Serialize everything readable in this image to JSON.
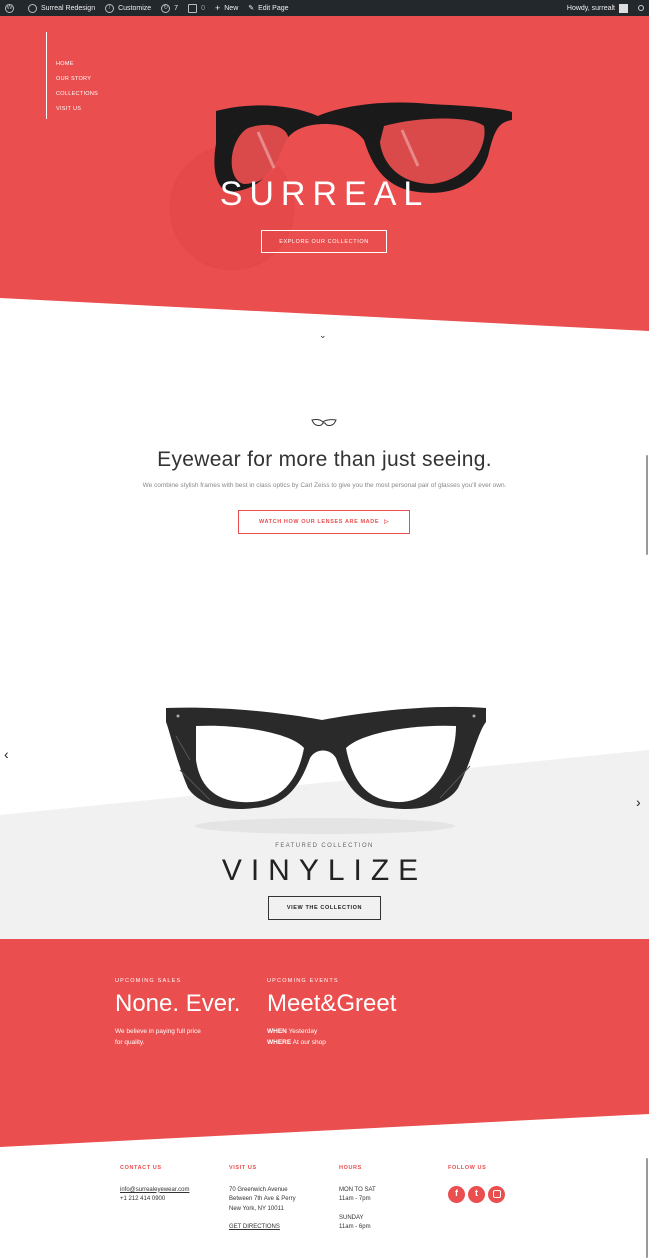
{
  "adminbar": {
    "site_name": "Surreal Redesign",
    "customize": "Customize",
    "updates_count": "7",
    "comments_count": "0",
    "new_label": "New",
    "edit_page": "Edit Page",
    "howdy": "Howdy, surrealt"
  },
  "nav": {
    "items": [
      "HOME",
      "OUR STORY",
      "COLLECTIONS",
      "VISIT US"
    ]
  },
  "hero": {
    "logo": "SURREAL",
    "button": "EXPLORE OUR COLLECTION"
  },
  "intro": {
    "title": "Eyewear for more than just seeing.",
    "text": "We combine stylish frames with best in class optics by Carl Zeiss to give you the most personal pair of glasses you'll ever own.",
    "button": "WATCH HOW OUR LENSES ARE MADE"
  },
  "featured": {
    "label": "FEATURED COLLECTION",
    "title": "VINYLIZE",
    "button": "VIEW THE COLLECTION"
  },
  "sales": {
    "label": "UPCOMING SALES",
    "heading": "None. Ever.",
    "text1": "We believe in paying full price",
    "text2": "for quality."
  },
  "events": {
    "label": "UPCOMING EVENTS",
    "heading": "Meet&Greet",
    "when_label": "WHEN",
    "when_value": "Yesterday",
    "where_label": "WHERE",
    "where_value": "At our shop"
  },
  "footer": {
    "contact": {
      "heading": "CONTACT US",
      "email": "info@surrealeyewear.com",
      "phone": "+1 212 414 0900"
    },
    "visit": {
      "heading": "VISIT US",
      "line1": "70 Greenwich Avenue",
      "line2": "Between 7th Ave & Perry",
      "line3": "New York, NY 10011",
      "directions": "GET DIRECTIONS"
    },
    "hours": {
      "heading": "HOURS",
      "days1": "MON TO SAT",
      "time1": "11am - 7pm",
      "days2": "SUNDAY",
      "time2": "11am - 6pm"
    },
    "follow": {
      "heading": "FOLLOW US",
      "icons": [
        "facebook-icon",
        "twitter-icon",
        "instagram-icon"
      ]
    }
  },
  "colors": {
    "brand_red": "#ea4e4e",
    "admin_bar": "#23282d"
  }
}
